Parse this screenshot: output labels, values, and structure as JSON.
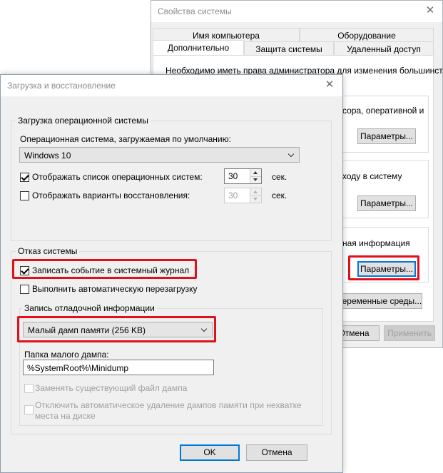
{
  "sysprops": {
    "title": "Свойства системы",
    "tabs_top": [
      "Имя компьютера",
      "Оборудование"
    ],
    "tabs_bottom": [
      "Дополнительно",
      "Защита системы",
      "Удаленный доступ"
    ],
    "notice": "Необходимо иметь права администратора для изменения большинства",
    "perf_text": "сора, оперативной и",
    "profiles_text": "ходу в систему",
    "startup_text": "ная информация",
    "params_label": "Параметры...",
    "env_label": "Переменные среды...",
    "cancel_label": "Отмена",
    "apply_label": "Применить"
  },
  "bootdlg": {
    "title": "Загрузка и восстановление",
    "startup_group": "Загрузка операционной системы",
    "default_os_label": "Операционная система, загружаемая по умолчанию:",
    "default_os_value": "Windows 10",
    "show_os_list_label": "Отображать список операционных систем:",
    "show_os_list_checked": true,
    "show_os_list_value": "30",
    "show_recovery_label": "Отображать варианты восстановления:",
    "show_recovery_checked": false,
    "show_recovery_value": "30",
    "sec_label": "сек.",
    "failure_group": "Отказ системы",
    "write_event_label": "Записать событие в системный журнал",
    "write_event_checked": true,
    "auto_restart_label": "Выполнить автоматическую перезагрузку",
    "auto_restart_checked": false,
    "debug_group": "Запись отладочной информации",
    "dump_type_value": "Малый дамп памяти (256 KB)",
    "dump_folder_label": "Папка малого дампа:",
    "dump_folder_value": "%SystemRoot%\\Minidump",
    "overwrite_label": "Заменять существующий файл дампа",
    "disable_autodelete_label_1": "Отключить автоматическое удаление дампов памяти при нехватке",
    "disable_autodelete_label_2": "места на диске",
    "ok_label": "OK",
    "cancel_label": "Отмена"
  },
  "colors": {
    "highlight": "#e0101c",
    "dialog_bg": "#f0f0f0",
    "accent": "#0078d7"
  }
}
